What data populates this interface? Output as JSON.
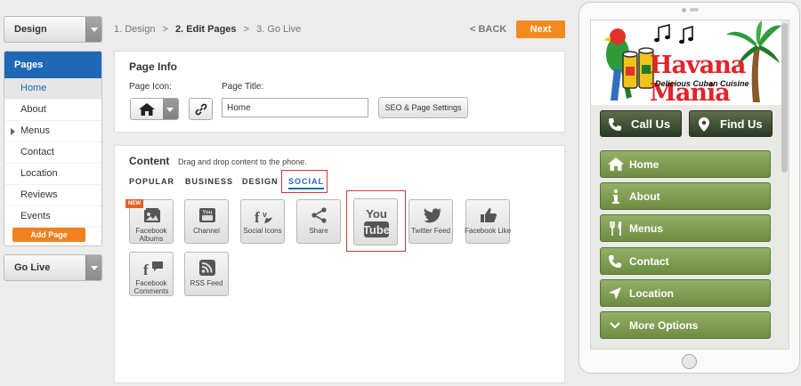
{
  "sidebar": {
    "design_label": "Design",
    "pages_header": "Pages",
    "pages": [
      {
        "label": "Home"
      },
      {
        "label": "About"
      },
      {
        "label": "Menus"
      },
      {
        "label": "Contact"
      },
      {
        "label": "Location"
      },
      {
        "label": "Reviews"
      },
      {
        "label": "Events"
      }
    ],
    "add_page_label": "Add Page",
    "go_live_label": "Go Live"
  },
  "steps": {
    "step1": "1. Design",
    "step2": "2. Edit Pages",
    "step3": "3. Go Live",
    "sep": ">"
  },
  "back_label": "< BACK",
  "next_label": "Next",
  "page_info": {
    "title": "Page Info",
    "icon_label": "Page Icon:",
    "page_title_label": "Page Title:",
    "page_title_value": "Home",
    "seo_label": "SEO & Page Settings"
  },
  "content": {
    "title": "Content",
    "hint": "Drag and drop content to the phone.",
    "tabs": [
      {
        "label": "POPULAR"
      },
      {
        "label": "BUSINESS"
      },
      {
        "label": "DESIGN"
      },
      {
        "label": "SOCIAL"
      }
    ],
    "new_badge": "NEW",
    "tiles": [
      {
        "label": "Facebook Albums"
      },
      {
        "label": "Channel"
      },
      {
        "label": "Social Icons"
      },
      {
        "label": "Share"
      },
      {
        "label": "YouTube"
      },
      {
        "label": "Twitter Feed"
      },
      {
        "label": "Facebook Like"
      },
      {
        "label": "Facebook Comments"
      },
      {
        "label": "RSS Feed"
      }
    ]
  },
  "phone": {
    "logo_text": "Havana Mania",
    "logo_sub": "Delicious Cuban Cuisine",
    "call_label": "Call Us",
    "find_label": "Find Us",
    "nav": [
      {
        "label": "Home"
      },
      {
        "label": "About"
      },
      {
        "label": "Menus"
      },
      {
        "label": "Contact"
      },
      {
        "label": "Location"
      },
      {
        "label": "More Options"
      }
    ]
  },
  "colors": {
    "accent_blue": "#1e68b5",
    "accent_orange": "#f28a1e",
    "phone_green": "#7a9a4f",
    "highlight_red": "#d23a3a"
  }
}
